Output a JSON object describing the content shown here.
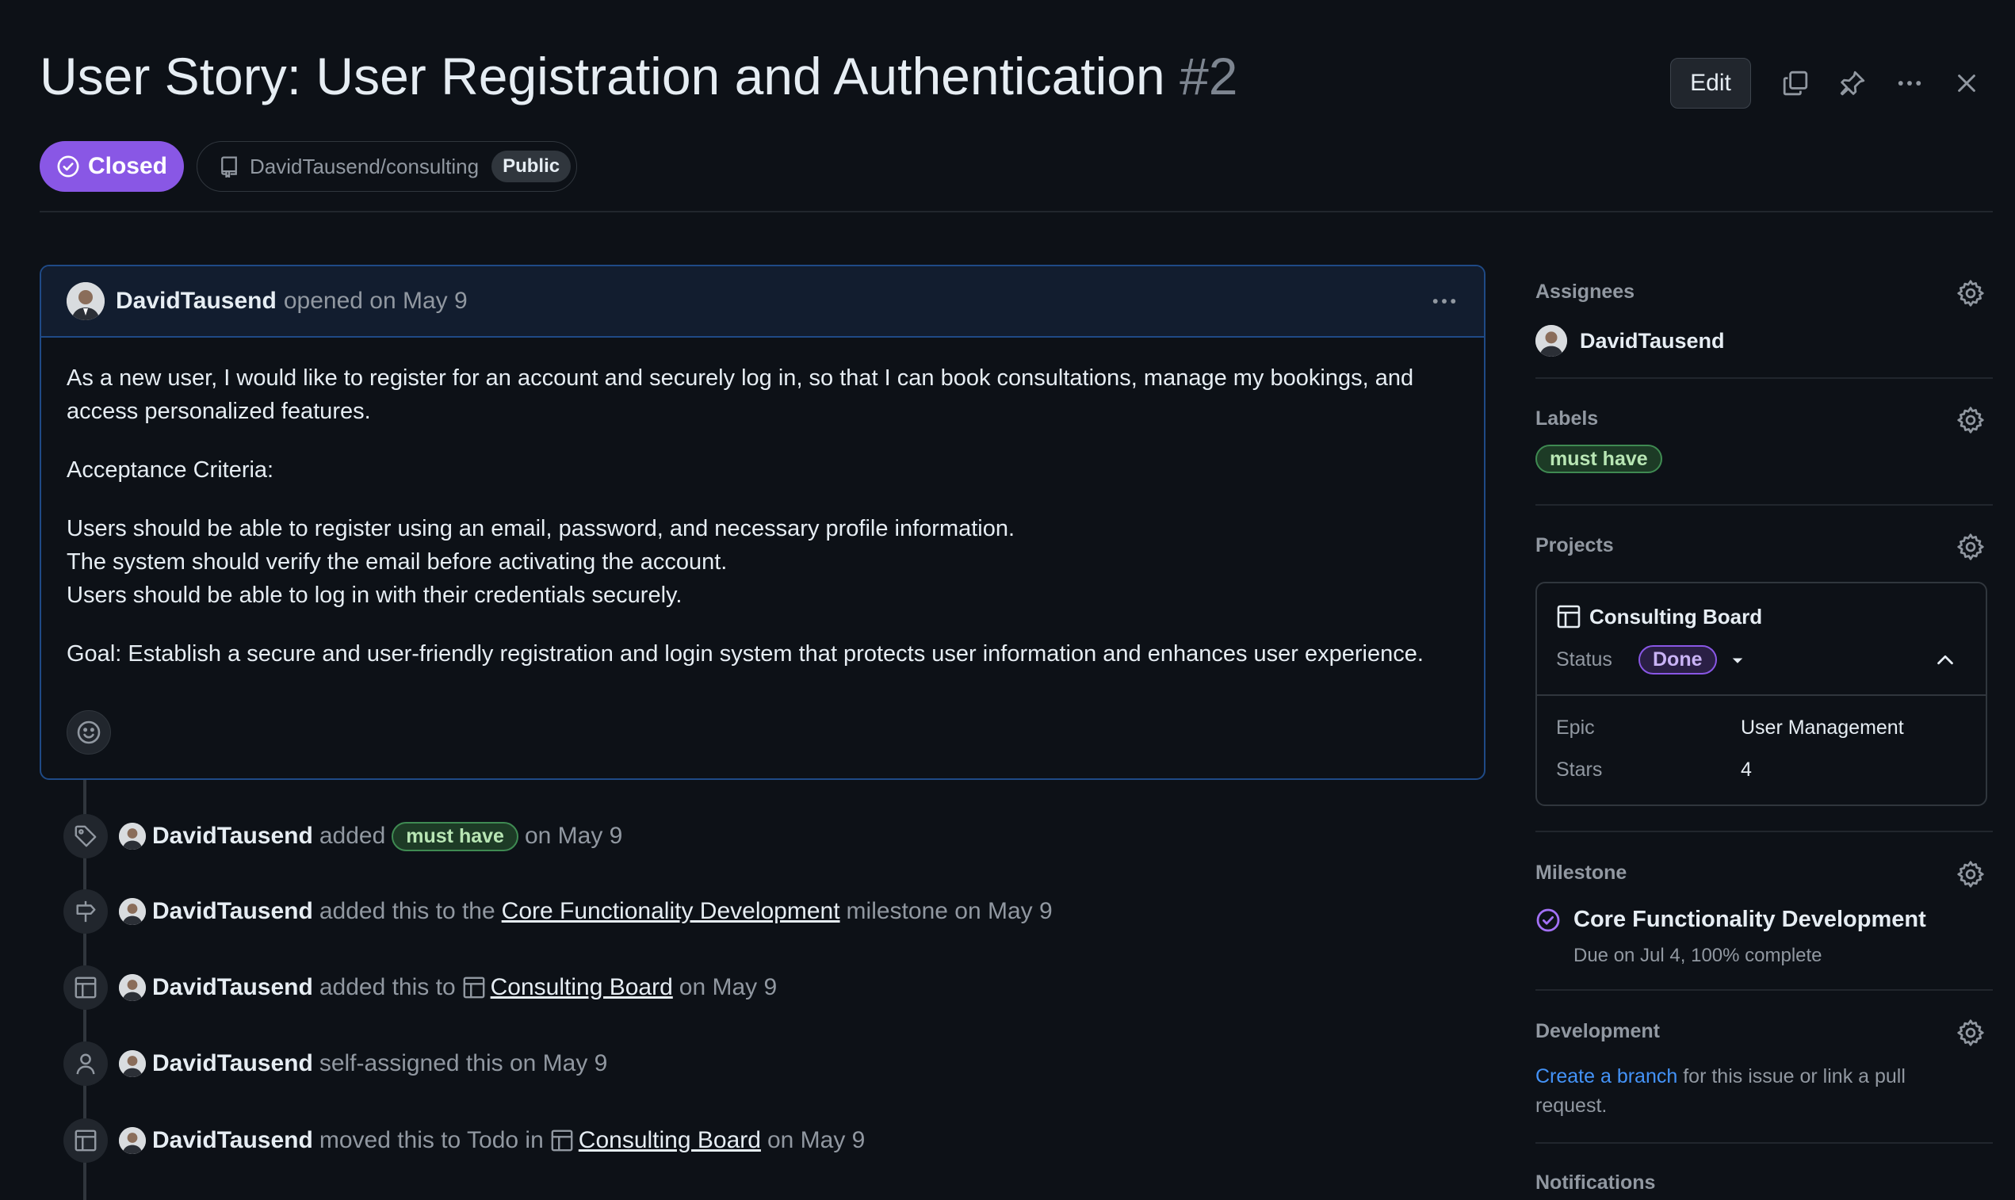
{
  "header": {
    "title": "User Story: User Registration and Authentication",
    "issue_number": "#2",
    "edit_label": "Edit",
    "status": "Closed",
    "repo": "DavidTausend/consulting",
    "visibility": "Public"
  },
  "comment": {
    "author": "DavidTausend",
    "meta": "opened on May 9",
    "body": [
      "As a new user, I would like to register for an account and securely log in, so that I can book consultations, manage my bookings, and access personalized features.",
      "Acceptance Criteria:",
      "Users should be able to register using an email, password, and necessary profile information.\nThe system should verify the email before activating the account.\nUsers should be able to log in with their credentials securely.",
      "Goal: Establish a secure and user-friendly registration and login system that protects user information and enhances user experience."
    ]
  },
  "timeline": [
    {
      "icon": "tag-icon",
      "author": "DavidTausend",
      "action": "added",
      "label": "must have",
      "suffix": "on May 9"
    },
    {
      "icon": "milestone-icon",
      "author": "DavidTausend",
      "action": "added this to the",
      "link": "Core Functionality Development",
      "suffix": "milestone on May 9"
    },
    {
      "icon": "table-icon",
      "author": "DavidTausend",
      "action": "added this to",
      "link": "Consulting Board",
      "suffix": "on May 9"
    },
    {
      "icon": "person-icon",
      "author": "DavidTausend",
      "action": "self-assigned this on May 9"
    },
    {
      "icon": "table-icon",
      "author": "DavidTausend",
      "action": "moved this to Todo in",
      "link": "Consulting Board",
      "suffix": "on May 9"
    }
  ],
  "sidebar": {
    "assignees": {
      "title": "Assignees",
      "name": "DavidTausend"
    },
    "labels": {
      "title": "Labels",
      "label": "must have"
    },
    "projects": {
      "title": "Projects",
      "board": "Consulting Board",
      "status_label": "Status",
      "status_value": "Done",
      "fields": [
        {
          "name": "Epic",
          "value": "User Management"
        },
        {
          "name": "Stars",
          "value": "4"
        }
      ]
    },
    "milestone": {
      "title": "Milestone",
      "name": "Core Functionality Development",
      "due": "Due on Jul 4, 100% complete"
    },
    "development": {
      "title": "Development",
      "link": "Create a branch",
      "text": "for this issue or link a pull",
      "text2": "request."
    },
    "notifications": {
      "title": "Notifications"
    }
  },
  "colors": {
    "accent_purple": "#8957e5",
    "label_green": "#3f8a52",
    "link_blue": "#4493f8",
    "bg": "#0d1117"
  }
}
